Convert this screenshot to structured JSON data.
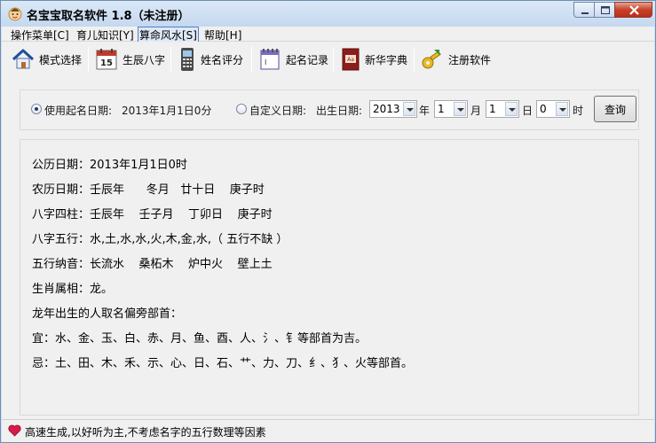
{
  "window": {
    "title": "名宝宝取名软件 1.8（未注册）"
  },
  "menu": {
    "items": [
      {
        "label": "操作菜单[C]"
      },
      {
        "label": "育儿知识[Y]"
      },
      {
        "label": "算命风水[S]"
      },
      {
        "label": "帮助[H]"
      }
    ]
  },
  "toolbar": {
    "items": [
      {
        "label": "模式选择",
        "icon": "home-icon"
      },
      {
        "label": "生辰八字",
        "icon": "calendar-icon"
      },
      {
        "label": "姓名评分",
        "icon": "phone-icon"
      },
      {
        "label": "起名记录",
        "icon": "notepad-icon"
      },
      {
        "label": "新华字典",
        "icon": "dictionary-icon"
      },
      {
        "label": "注册软件",
        "icon": "key-icon"
      }
    ]
  },
  "query": {
    "use_date_label": "使用起名日期:",
    "use_date_value": "2013年1月1日0分",
    "custom_date_label": "自定义日期:",
    "birth_label": "出生日期:",
    "year_value": "2013",
    "year_unit": "年",
    "month_value": "1",
    "month_unit": "月",
    "day_value": "1",
    "day_unit": "日",
    "hour_value": "0",
    "hour_unit": "时",
    "query_button": "查询"
  },
  "result": {
    "lines": [
      "公历日期：2013年1月1日0时",
      "农历日期：壬辰年      冬月   廿十日    庚子时",
      "八字四柱：壬辰年    壬子月    丁卯日    庚子时",
      "八字五行：水,土,水,水,火,木,金,水,（ 五行不缺 ）",
      "五行纳音：长流水    桑柘木    炉中火    壁上土",
      "生肖属相：龙。",
      "龙年出生的人取名偏旁部首：",
      "宜：水、金、玉、白、赤、月、鱼、酉、人、氵、钅等部首为吉。",
      "忌：土、田、木、禾、示、心、日、石、艹、力、刀、纟、犭、火等部首。"
    ]
  },
  "status": {
    "text": "高速生成,以好听为主,不考虑名字的五行数理等因素"
  },
  "colors": {
    "titlebar": "#c4d8ef",
    "close_button": "#c7412a",
    "selected_radio": "#233a79"
  }
}
